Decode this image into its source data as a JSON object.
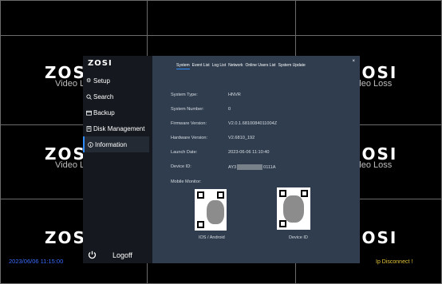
{
  "camera_grid": {
    "logo_text": "ZOSI",
    "status_text": "Video Loss"
  },
  "footer": {
    "timestamp": "2023/06/06 11:15:00",
    "connection_status": "Ip Disconnect !"
  },
  "sidebar": {
    "brand": "ZOSI",
    "items": [
      {
        "label": "Setup",
        "icon": "gear-icon"
      },
      {
        "label": "Search",
        "icon": "search-icon"
      },
      {
        "label": "Backup",
        "icon": "backup-icon"
      },
      {
        "label": "Disk Management",
        "icon": "disk-icon"
      },
      {
        "label": "Information",
        "icon": "info-icon",
        "active": true
      }
    ],
    "logoff_label": "Logoff"
  },
  "tabs": [
    "System",
    "Event List",
    "Log List",
    "Network",
    "Online Users List",
    "System Update"
  ],
  "active_tab": "System",
  "close_glyph": "×",
  "system_info": {
    "system_type_label": "System Type:",
    "system_type": "HNVR",
    "system_number_label": "System Number:",
    "system_number": "0",
    "firmware_label": "Firmware Version:",
    "firmware": "V2.0.1.6810084011004Z",
    "hardware_label": "Hardware Version:",
    "hardware": "V2.6810_192",
    "launch_label": "Launch Date:",
    "launch_date": "2023-06-06 11:10:40",
    "device_id_label": "Device ID:",
    "device_id_prefix": "AY3",
    "device_id_suffix": "0111A",
    "mobile_monitor_label": "Mobile Monitor:"
  },
  "qr_codes": [
    {
      "label": "IOS / Android"
    },
    {
      "label": "Device ID"
    }
  ]
}
